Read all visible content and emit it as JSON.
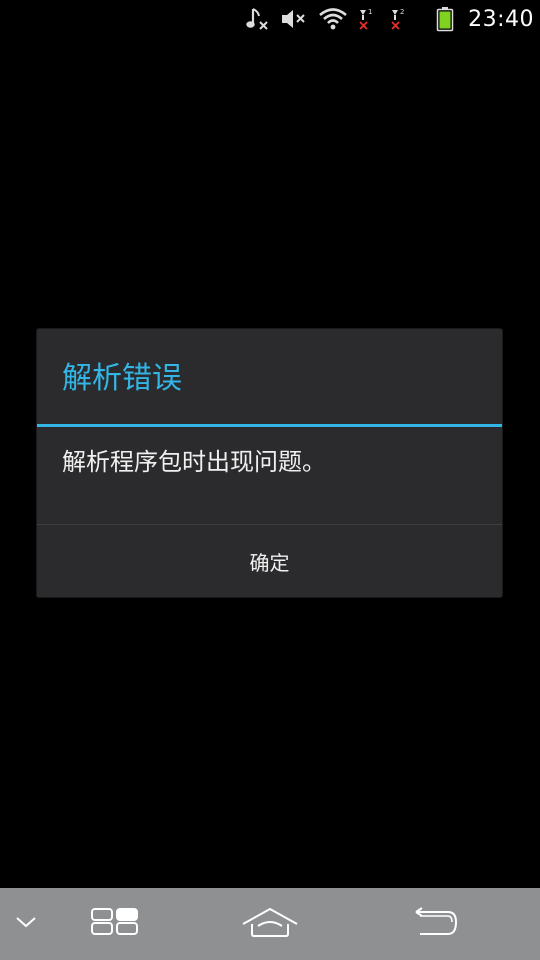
{
  "status_bar": {
    "time": "23:40",
    "icons": [
      "music-muted-icon",
      "volume-muted-icon",
      "wifi-icon",
      "signal-sim1-no-service-icon",
      "signal-sim2-no-service-icon",
      "battery-icon"
    ],
    "battery_color": "#7ed321"
  },
  "dialog": {
    "title": "解析错误",
    "message": "解析程序包时出现问题。",
    "ok_label": "确定",
    "accent_color": "#33b5e5"
  },
  "nav_bar": {
    "buttons": [
      "collapse-icon",
      "recent-apps-icon",
      "home-icon",
      "back-icon"
    ]
  }
}
